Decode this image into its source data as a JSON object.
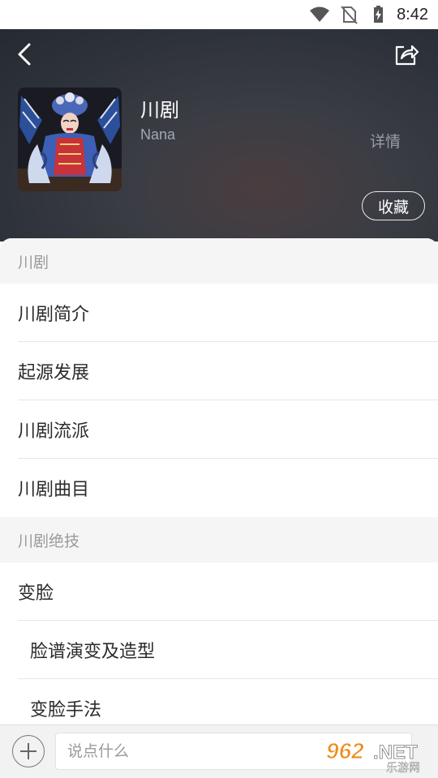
{
  "status_bar": {
    "time": "8:42",
    "icons": [
      "wifi-icon",
      "no-sim-icon",
      "battery-charging-icon"
    ]
  },
  "header": {
    "title": "川剧",
    "author": "Nana",
    "details_label": "详情",
    "collect_label": "收藏",
    "back_icon": "back-arrow-icon",
    "share_icon": "share-icon",
    "cover_image": "sichuan-opera-performer"
  },
  "sections": [
    {
      "title": "川剧",
      "items": [
        {
          "label": "川剧简介",
          "sub": false
        },
        {
          "label": "起源发展",
          "sub": false
        },
        {
          "label": "川剧流派",
          "sub": false
        },
        {
          "label": "川剧曲目",
          "sub": false
        }
      ]
    },
    {
      "title": "川剧绝技",
      "items": [
        {
          "label": "变脸",
          "sub": false
        },
        {
          "label": "脸谱演变及造型",
          "sub": true
        },
        {
          "label": "变脸手法",
          "sub": true
        }
      ]
    }
  ],
  "bottom_bar": {
    "comment_placeholder": "说点什么",
    "add_icon": "plus-icon"
  },
  "watermark": {
    "main": "962.NET",
    "sub": "乐游网"
  }
}
